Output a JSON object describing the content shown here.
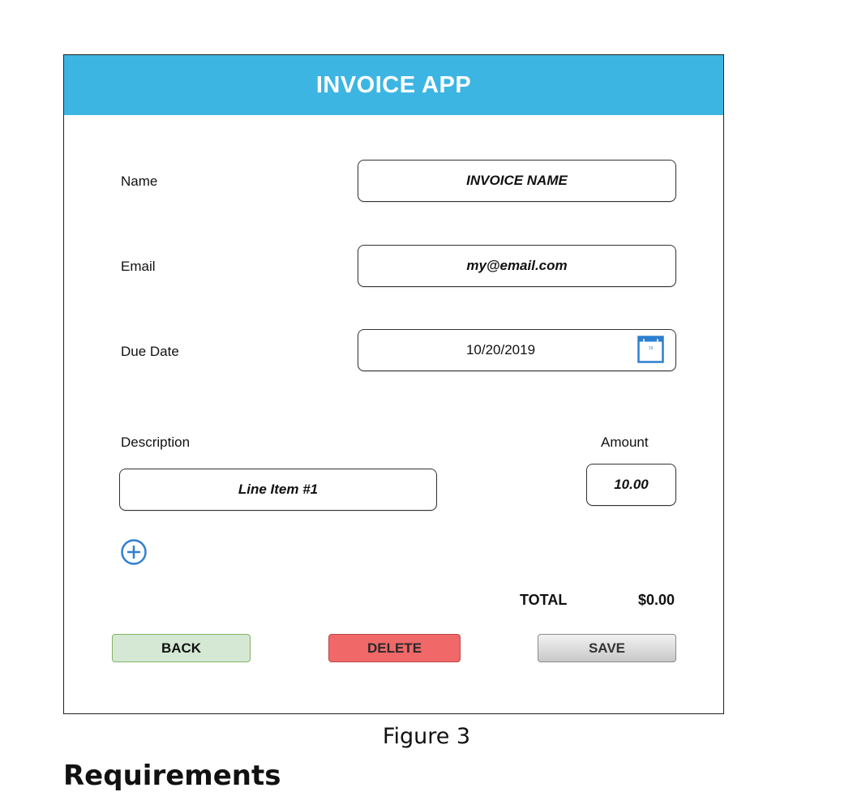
{
  "app": {
    "title": "INVOICE APP"
  },
  "form": {
    "name": {
      "label": "Name",
      "value": "INVOICE NAME"
    },
    "email": {
      "label": "Email",
      "value": "my@email.com"
    },
    "due_date": {
      "label": "Due Date",
      "value": "10/20/2019",
      "icon": "calendar-icon"
    }
  },
  "line_items": {
    "description_header": "Description",
    "amount_header": "Amount",
    "rows": [
      {
        "description": "Line Item #1",
        "amount": "10.00"
      }
    ],
    "add_icon": "plus-circle-icon"
  },
  "total": {
    "label": "TOTAL",
    "value": "$0.00"
  },
  "buttons": {
    "back": "BACK",
    "delete": "DELETE",
    "save": "SAVE"
  },
  "caption": "Figure 3",
  "next_heading_partial": "Requirements",
  "colors": {
    "header": "#3db5e3",
    "back": "#d5e8d4",
    "delete": "#f06868",
    "save": "#d0d0d0",
    "icon_blue": "#2f7fd0"
  }
}
